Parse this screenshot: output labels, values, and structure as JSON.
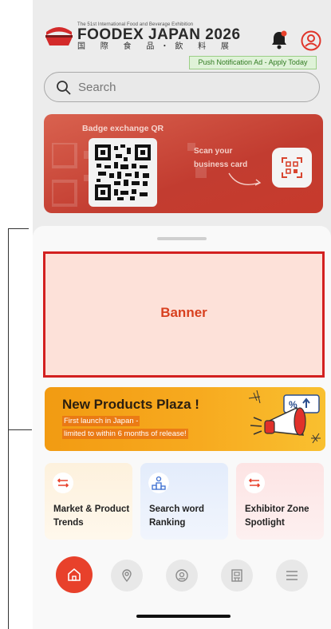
{
  "header": {
    "exhibition_small": "The 51st International Food and Beverage Exhibition",
    "logo_main": "FOODEX JAPAN 2026",
    "logo_kanji": "国 際 食 品・飲 料 展",
    "push_ad": "Push Notification Ad - Apply Today"
  },
  "search": {
    "placeholder": "Search"
  },
  "badge_card": {
    "label": "Badge exchange QR",
    "scan_text": "Scan your business card"
  },
  "banner": {
    "label": "Banner"
  },
  "plaza": {
    "title": "New Products Plaza !",
    "line1": "First launch in Japan -",
    "line2": "limited to within 6 months of release!"
  },
  "cards": [
    {
      "label": "Market & Product Trends",
      "icon": "swap-arrows-icon"
    },
    {
      "label": "Search word Ranking",
      "icon": "ranking-podium-icon"
    },
    {
      "label": "Exhibitor Zone Spotlight",
      "icon": "swap-arrows-icon"
    }
  ],
  "bottom_nav": [
    "home-icon",
    "map-pin-icon",
    "chat-search-icon",
    "exhibitor-booth-icon",
    "menu-icon"
  ],
  "colors": {
    "accent": "#e8412b",
    "banner_border": "#d32020",
    "banner_fill": "#fde1d9",
    "push_ad_bg": "#dff2d8",
    "plaza_orange": "#f7aa1f"
  }
}
